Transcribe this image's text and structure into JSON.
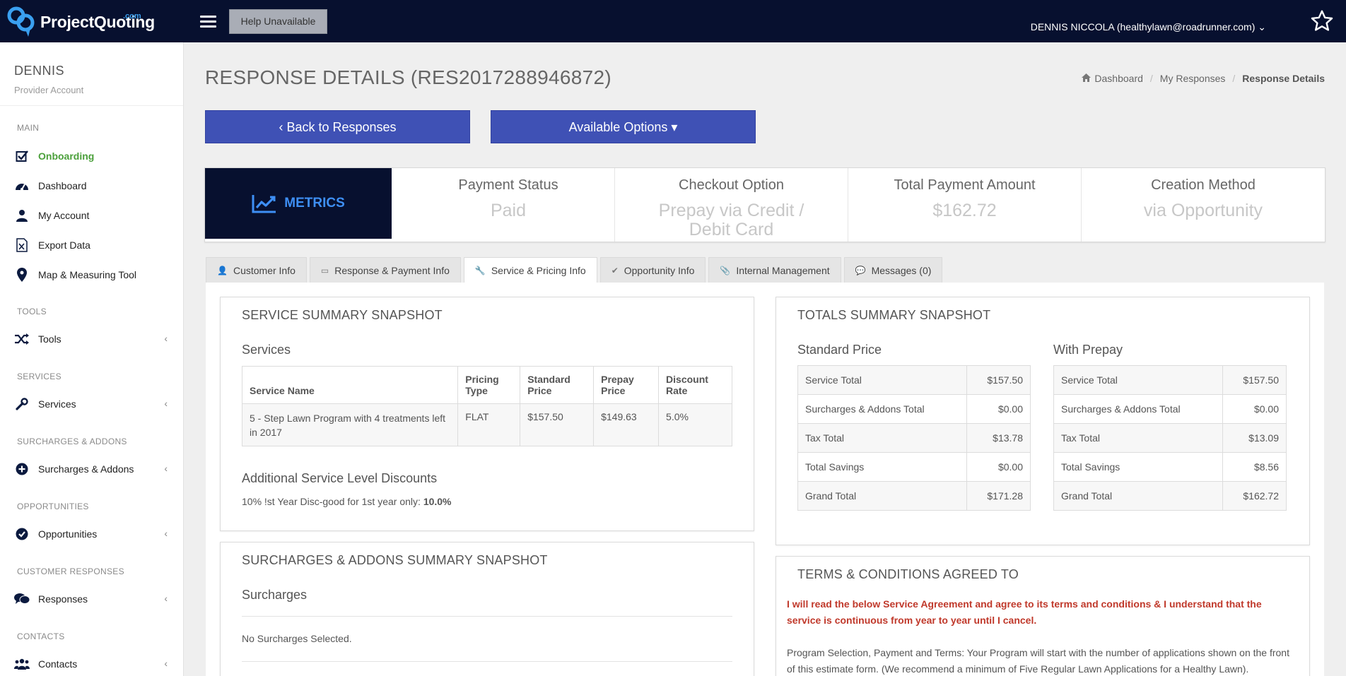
{
  "topbar": {
    "logo_text": "ProjectQuoting",
    "logo_suffix": ".com",
    "help_label": "Help Unavailable",
    "user_label": "DENNIS NICCOLA (healthylawn@roadrunner.com)",
    "user_caret": "⌄"
  },
  "sidebar": {
    "profile_name": "DENNIS",
    "profile_role": "Provider Account",
    "sections": {
      "main": "MAIN",
      "tools": "TOOLS",
      "services": "SERVICES",
      "surcharges": "SURCHARGES & ADDONS",
      "opportunities": "OPPORTUNITIES",
      "responses": "CUSTOMER RESPONSES",
      "contacts": "CONTACTS"
    },
    "items": {
      "onboarding": "Onboarding",
      "dashboard": "Dashboard",
      "my_account": "My Account",
      "export_data": "Export Data",
      "map_tool": "Map & Measuring Tool",
      "tools": "Tools",
      "services": "Services",
      "surcharges": "Surcharges & Addons",
      "opportunities": "Opportunities",
      "responses": "Responses",
      "contacts": "Contacts"
    },
    "chevron": "‹"
  },
  "page": {
    "title": "RESPONSE DETAILS (RES2017288946872)",
    "breadcrumb": {
      "dashboard": "Dashboard",
      "responses": "My Responses",
      "current": "Response Details",
      "sep": "/"
    },
    "back_button": "‹ Back to Responses",
    "options_button": "Available Options ▾"
  },
  "metrics": {
    "header": "METRICS",
    "items": [
      {
        "label": "Payment Status",
        "value": "Paid"
      },
      {
        "label": "Checkout Option",
        "value": "Prepay via Credit / Debit Card"
      },
      {
        "label": "Total Payment Amount",
        "value": "$162.72"
      },
      {
        "label": "Creation Method",
        "value": "via Opportunity"
      }
    ]
  },
  "tabs": [
    {
      "label": "Customer Info",
      "icon": "user-icon",
      "glyph": "👤"
    },
    {
      "label": "Response & Payment Info",
      "icon": "credit-card-icon",
      "glyph": "▭"
    },
    {
      "label": "Service & Pricing Info",
      "icon": "wrench-icon",
      "glyph": "🔧"
    },
    {
      "label": "Opportunity Info",
      "icon": "check-icon",
      "glyph": "✔"
    },
    {
      "label": "Internal Management",
      "icon": "paperclip-icon",
      "glyph": "📎"
    },
    {
      "label": "Messages (0)",
      "icon": "comment-icon",
      "glyph": "💬"
    }
  ],
  "service_summary": {
    "title": "SERVICE SUMMARY SNAPSHOT",
    "services_heading": "Services",
    "columns": [
      "Service Name",
      "Pricing Type",
      "Standard Price",
      "Prepay Price",
      "Discount Rate"
    ],
    "rows": [
      [
        "5 - Step Lawn Program with 4 treatments left in 2017",
        "FLAT",
        "$157.50",
        "$149.63",
        "5.0%"
      ]
    ],
    "discounts_heading": "Additional Service Level Discounts",
    "discount_text": "10% !st Year Disc-good for 1st year only: ",
    "discount_value": "10.0%"
  },
  "surcharges_summary": {
    "title": "SURCHARGES & ADDONS SUMMARY SNAPSHOT",
    "heading": "Surcharges",
    "empty_text": "No Surcharges Selected."
  },
  "totals_summary": {
    "title": "TOTALS SUMMARY SNAPSHOT",
    "standard": {
      "heading": "Standard Price",
      "rows": [
        [
          "Service Total",
          "$157.50"
        ],
        [
          "Surcharges & Addons Total",
          "$0.00"
        ],
        [
          "Tax Total",
          "$13.78"
        ],
        [
          "Total Savings",
          "$0.00"
        ],
        [
          "Grand Total",
          "$171.28"
        ]
      ]
    },
    "prepay": {
      "heading": "With Prepay",
      "rows": [
        [
          "Service Total",
          "$157.50"
        ],
        [
          "Surcharges & Addons Total",
          "$0.00"
        ],
        [
          "Tax Total",
          "$13.09"
        ],
        [
          "Total Savings",
          "$8.56"
        ],
        [
          "Grand Total",
          "$162.72"
        ]
      ]
    }
  },
  "terms": {
    "title": "TERMS & CONDITIONS AGREED TO",
    "agreement": "I will read the below Service Agreement and agree to its terms and conditions & I understand that the service is continuous from year to year until I cancel.",
    "body": "Program Selection, Payment and Terms: Your Program will start with the number of applications shown on the front of this estimate form. (We recommend a minimum of Five Regular Lawn Applications for a Healthy Lawn)."
  },
  "colors": {
    "topbar": "#07102f",
    "primary_button": "#3f51b5",
    "metrics_accent": "#3e8ff5",
    "onboarding_green": "#4ba03b",
    "terms_red": "#c0392b"
  }
}
